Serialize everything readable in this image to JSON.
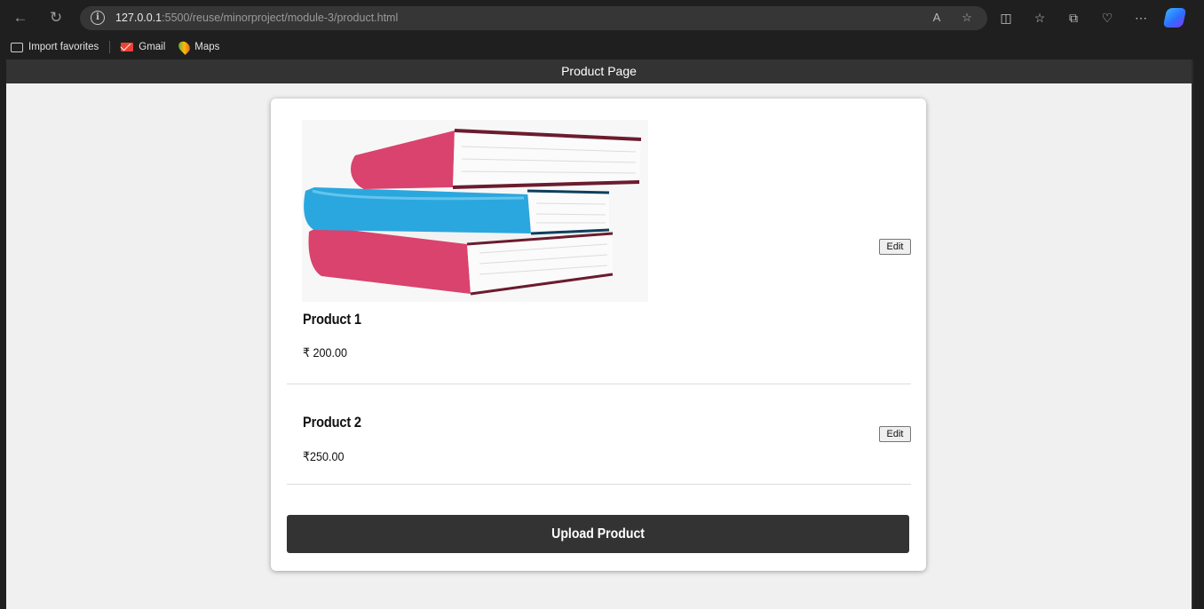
{
  "browser": {
    "url_host": "127.0.0.1",
    "url_path": ":5500/reuse/minorproject/module-3/product.html",
    "bookmarks": [
      {
        "label": "Import favorites"
      },
      {
        "label": "Gmail"
      },
      {
        "label": "Maps"
      }
    ]
  },
  "page": {
    "header_title": "Product Page"
  },
  "products": [
    {
      "name": "Product 1",
      "price": "₹ 200.00",
      "edit_label": "Edit",
      "image": "books-stack"
    },
    {
      "name": "Product 2",
      "price": "₹250.00",
      "edit_label": "Edit"
    }
  ],
  "actions": {
    "upload_label": "Upload Product"
  },
  "colors": {
    "header_bg": "#333333",
    "page_bg": "#f0f0f0",
    "card_bg": "#ffffff",
    "book_pink": "#d9436e",
    "book_blue": "#2aa7de"
  }
}
